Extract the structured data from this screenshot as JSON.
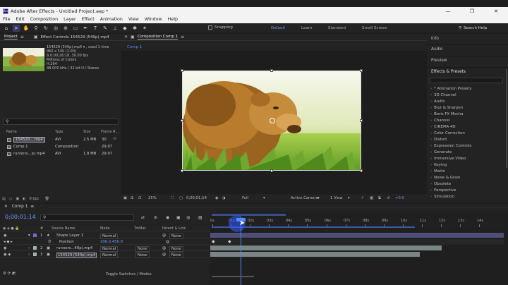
{
  "window": {
    "title": "Adobe After Effects - Untitled Project.aep *",
    "app_badge": "Ae",
    "controls": [
      "—",
      "❐",
      "✕"
    ]
  },
  "menu": [
    "File",
    "Edit",
    "Composition",
    "Layer",
    "Effect",
    "Animation",
    "View",
    "Window",
    "Help"
  ],
  "toolbar": {
    "snapping_label": "Snapping",
    "workspaces": [
      "Default",
      "Learn",
      "Standard",
      "Small Screen"
    ],
    "search_placeholder": "Search Help",
    "tool_icons": [
      "home-icon",
      "selection-icon",
      "hand-icon",
      "zoom-icon",
      "rotate-icon",
      "camera-icon",
      "pan-behind-icon",
      "rectangle-icon",
      "pen-icon",
      "type-icon",
      "brush-icon",
      "clone-icon",
      "eraser-icon",
      "roto-icon",
      "puppet-icon"
    ]
  },
  "project": {
    "tab_project": "Project",
    "tab_effect_controls": "Effect Controls 154529 (540p).mp4",
    "info": [
      "154529 (540p).mp4 ▾ , used 1 time",
      "960 x 540 (1.00)",
      "Δ 0;00;26;18, 30.00 fps",
      "Millions of Colors",
      "H.264",
      "48.000 kHz / 32 bit U / Stereo"
    ],
    "columns": {
      "name": "Name",
      "type": "Type",
      "size": "Size",
      "frame_rate": "Frame R..."
    },
    "items": [
      {
        "name": "154529 ...mp4",
        "type": "AVI",
        "size": "2.5 MB",
        "fps": "30"
      },
      {
        "name": "Comp 1",
        "type": "Composition",
        "size": "",
        "fps": "29.97"
      },
      {
        "name": "runners...p).mp4",
        "type": "AVI",
        "size": "1.8 MB",
        "fps": "29.97"
      }
    ],
    "footer_bpc": "8 bpc"
  },
  "viewer": {
    "tab_label": "Composition Comp 1",
    "subtab": "Comp 1",
    "zoom": "25%",
    "timecode": "0;00;01;14",
    "resolution": "Full",
    "camera": "Active Camera",
    "views": "1 View",
    "exposure": "+0.0"
  },
  "right_panel": {
    "info": "Info",
    "audio": "Audio",
    "preview": "Preview",
    "effects_title": "Effects & Presets",
    "effects": [
      "* Animation Presets",
      "3D Channel",
      "Audio",
      "Blur & Sharpen",
      "Boris FX Mocha",
      "Channel",
      "CINEMA 4D",
      "Color Correction",
      "Distort",
      "Expression Controls",
      "Generate",
      "Immersive Video",
      "Keying",
      "Matte",
      "Noise & Grain",
      "Obsolete",
      "Perspective",
      "Simulation"
    ]
  },
  "timeline": {
    "tab_label": "Comp 1",
    "timecode": "0;00;01;14",
    "headers": {
      "num": "#",
      "source": "Source Name",
      "mode": "Mode",
      "trkmat": "TrkMat",
      "parent": "Parent & Link"
    },
    "layers": [
      {
        "num": "1",
        "name": "Shape Layer 1",
        "mode": "Normal",
        "trkmat": "",
        "parent": "None"
      },
      {
        "num": "",
        "name": "Position",
        "mode": "206.0,450.0",
        "trkmat": "",
        "parent": ""
      },
      {
        "num": "2",
        "name": "runners...40p).mp4",
        "mode": "Normal",
        "trkmat": "None",
        "parent": "None"
      },
      {
        "num": "3",
        "name": "154529 (540p).mp4",
        "mode": "Normal",
        "trkmat": "None",
        "parent": "None"
      }
    ],
    "toggle_label": "Toggle Switches / Modes",
    "ruler": [
      "0s",
      "01s",
      "02s",
      "03s",
      "04s",
      "05s",
      "06s",
      "07s",
      "08s",
      "09s",
      "10s",
      "11s",
      "12s",
      "13s",
      "14s"
    ]
  },
  "colors": {
    "accent_blue": "#4f8cff",
    "layer_purple": "#4e4e78",
    "layer_gray": "#7b8585"
  }
}
